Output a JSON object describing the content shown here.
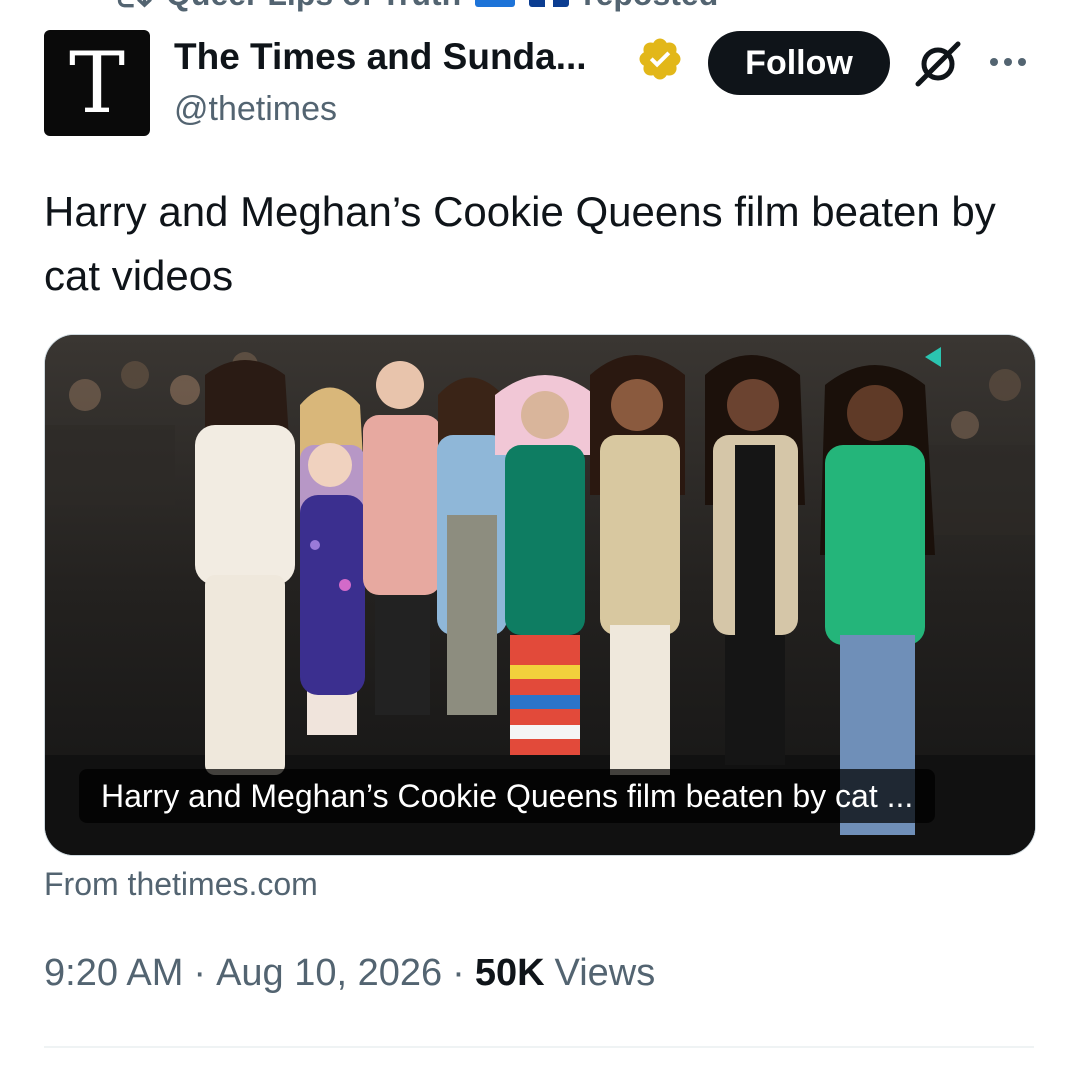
{
  "repost_bar": {
    "text_before": "Queer Lips of Truth",
    "text_after": "reposted",
    "icon": "repost-icon"
  },
  "author": {
    "avatar_letter": "T",
    "display_name": "The Times and Sunda...",
    "handle": "@thetimes",
    "verified_badge": "verified-gold-badge-icon"
  },
  "header_actions": {
    "follow_label": "Follow",
    "grok_icon": "grok-icon",
    "more_icon": "more-options-icon"
  },
  "tweet": {
    "text": "Harry and Meghan’s Cookie Queens film beaten by cat videos"
  },
  "link_card": {
    "caption": "Harry and Meghan’s Cookie Queens film beaten by cat ...",
    "source": "From thetimes.com"
  },
  "meta": {
    "time": "9:20 AM",
    "date": "Aug 10, 2026",
    "separator": "·",
    "views_count": "50K",
    "views_label": "Views"
  },
  "colors": {
    "text_primary": "#0f1419",
    "text_secondary": "#536471",
    "follow_bg": "#0f1419",
    "verified_gold": "#e2b719",
    "border": "#cfd9de"
  }
}
